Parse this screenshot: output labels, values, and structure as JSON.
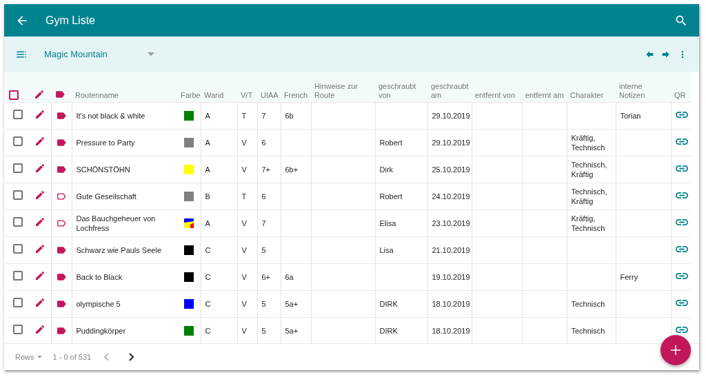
{
  "app_bar": {
    "title": "Gym Liste"
  },
  "toolbar": {
    "gym": "Magic Mountain"
  },
  "table": {
    "select_all": {
      "checked": false
    },
    "columns": [
      "Routenname",
      "Farbe",
      "Wand",
      "V/T",
      "UIAA",
      "French",
      "Hinweise zur Route",
      "geschraubt von",
      "geschraubt am",
      "entfernt von",
      "entfernt am",
      "Charakter",
      "interne Notizen",
      "QR"
    ],
    "rows": [
      {
        "checked": false,
        "tagged": true,
        "name": "It's not black & white",
        "color": "#008000",
        "wall": "A",
        "vt": "T",
        "uiaa": "7",
        "french": "6b",
        "set_on": "29.10.2019",
        "notes": "Torian"
      },
      {
        "checked": false,
        "tagged": true,
        "name": "Pressure to Party",
        "color": "#808080",
        "wall": "A",
        "vt": "V",
        "uiaa": "6",
        "set_by": "Robert",
        "set_on": "29.10.2019",
        "character": "Kräftig, Technisch"
      },
      {
        "checked": false,
        "tagged": true,
        "name": "SCHÖNSTÖHN",
        "color": "#ffff00",
        "wall": "A",
        "vt": "V",
        "uiaa": "7+",
        "french": "6b+",
        "set_by": "Dirk",
        "set_on": "25.10.2019",
        "character": "Technisch, Kräftig"
      },
      {
        "checked": false,
        "tagged": false,
        "name": "Gute Geseilschaft",
        "color": "#808080",
        "wall": "B",
        "vt": "T",
        "uiaa": "6",
        "set_by": "Robert",
        "set_on": "24.10.2019",
        "character": "Technisch, Kräftig"
      },
      {
        "checked": false,
        "tagged": false,
        "name": "Das Bauchgeheuer von Lochfress",
        "colors": [
          {
            "color": "#0000ff"
          },
          {
            "color": "#ffff00"
          },
          {
            "color": "#ff0000"
          }
        ],
        "wall": "A",
        "vt": "V",
        "uiaa": "7",
        "set_by": "Elisa",
        "set_on": "23.10.2019",
        "character": "Kräftig, Technisch"
      },
      {
        "checked": false,
        "tagged": true,
        "name": "Schwarz wie Pauls Seele",
        "color": "#000000",
        "wall": "C",
        "vt": "V",
        "uiaa": "5",
        "set_by": "Lisa",
        "set_on": "21.10.2019"
      },
      {
        "checked": false,
        "tagged": true,
        "name": "Back to Black",
        "color": "#000000",
        "wall": "C",
        "vt": "V",
        "uiaa": "6+",
        "french": "6a",
        "set_on": "19.10.2019",
        "notes": "Ferry"
      },
      {
        "checked": false,
        "tagged": true,
        "name": "olympische 5",
        "color": "#0000ff",
        "wall": "C",
        "vt": "V",
        "uiaa": "5",
        "french": "5a+",
        "set_by": "DIRK",
        "set_on": "18.10.2019",
        "character": "Technisch"
      },
      {
        "checked": false,
        "tagged": true,
        "name": "Puddingkörper",
        "color": "#008000",
        "wall": "C",
        "vt": "V",
        "uiaa": "5",
        "french": "5a+",
        "set_by": "DIRK",
        "set_on": "18.10.2019",
        "character": "Technisch"
      }
    ]
  },
  "pagination": {
    "rows_label": "Rows",
    "range": "1 - 0 of 531",
    "previous_disabled": true,
    "next_disabled": false
  }
}
